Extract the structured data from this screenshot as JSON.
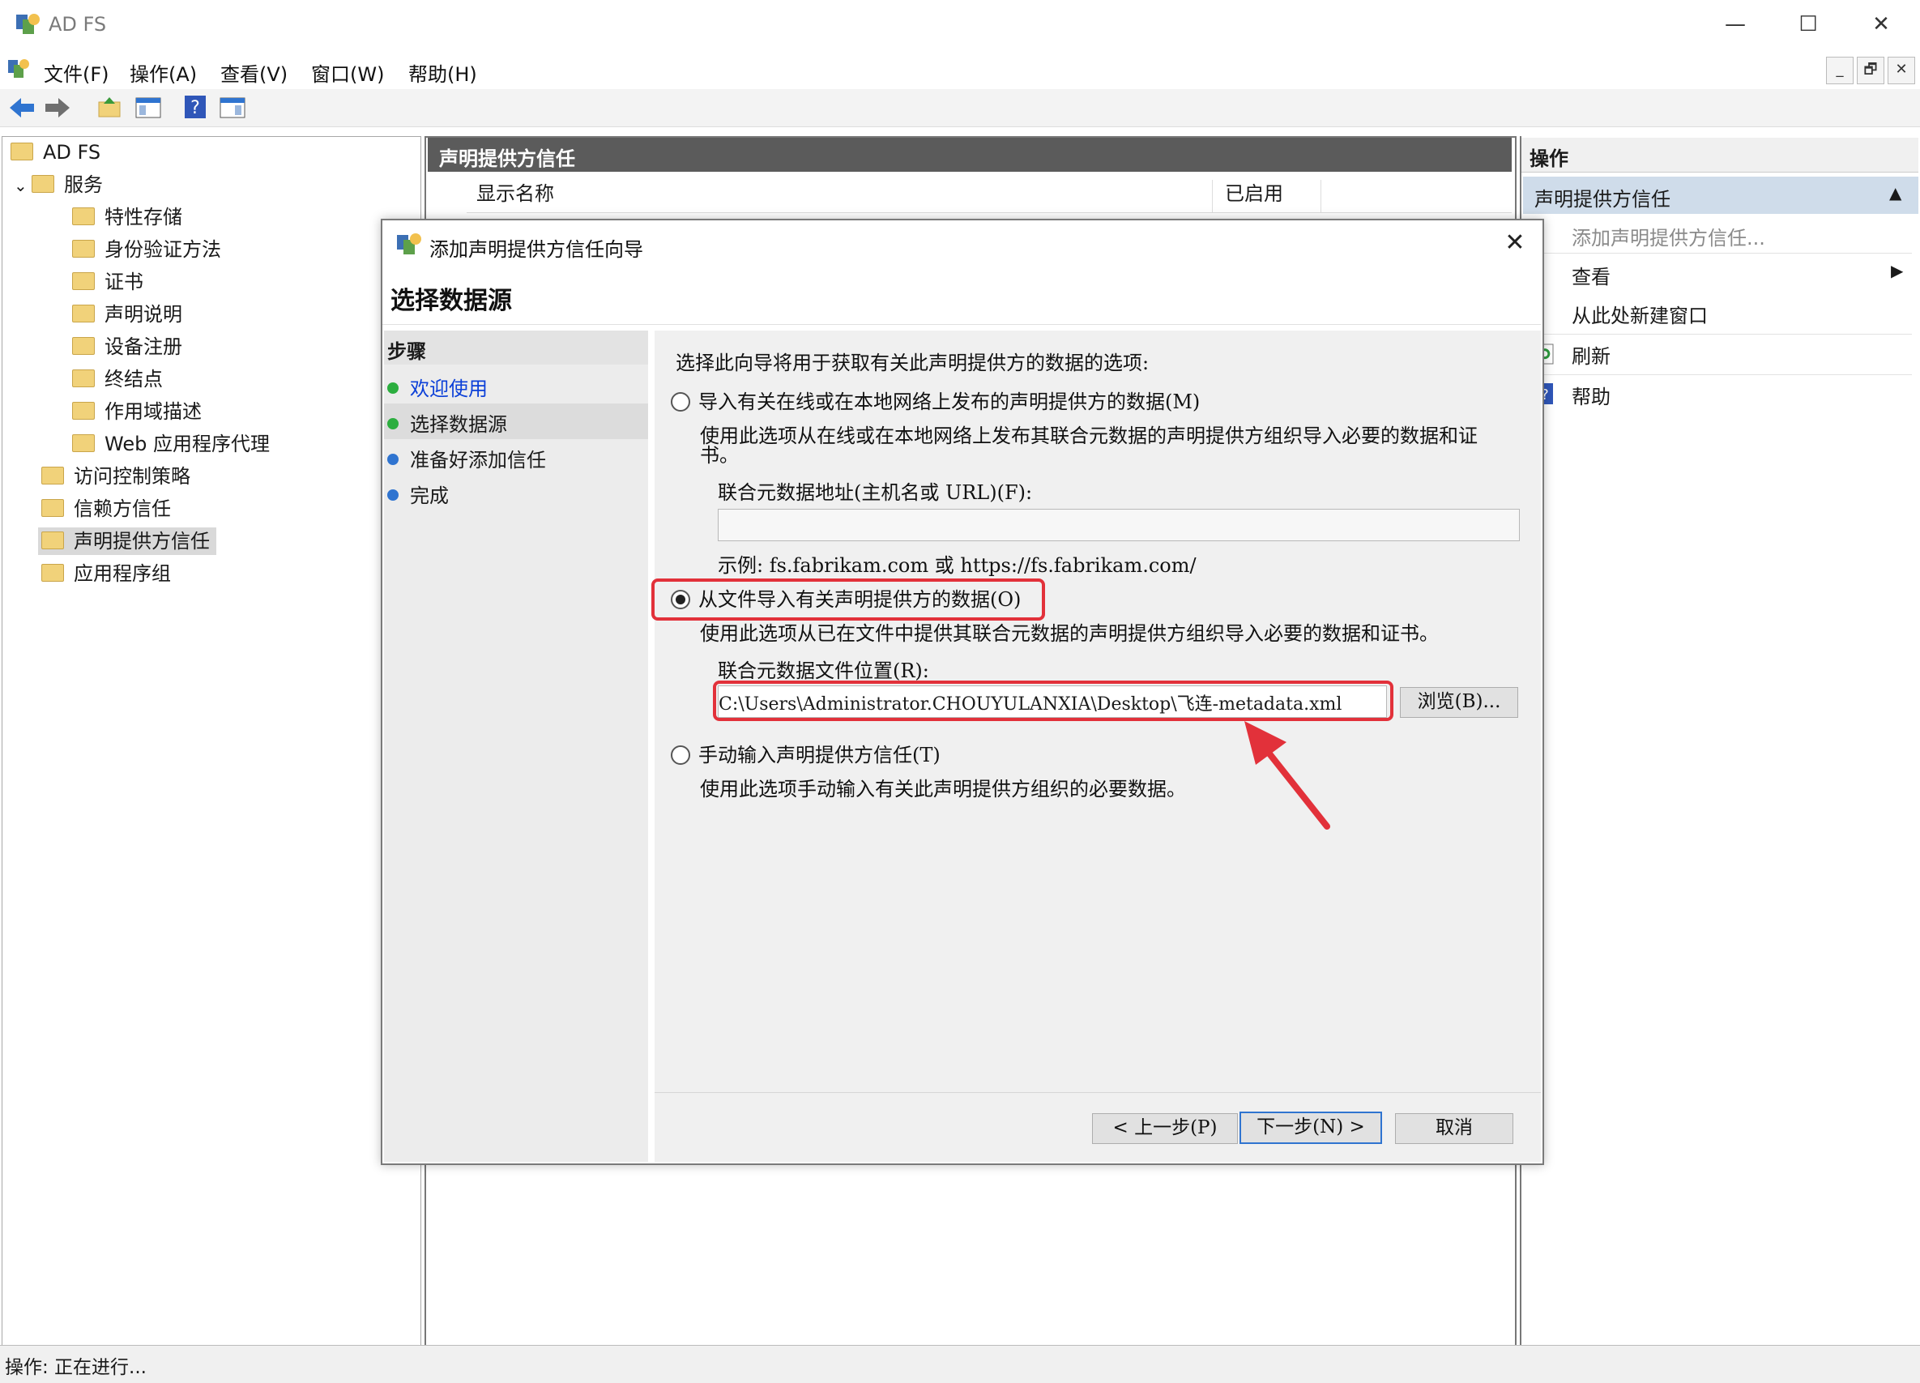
{
  "window": {
    "title": "AD FS",
    "minimize_glyph": "—",
    "maximize_glyph": "☐",
    "close_glyph": "✕"
  },
  "menu": [
    "文件(F)",
    "操作(A)",
    "查看(V)",
    "窗口(W)",
    "帮助(H)"
  ],
  "mdi_controls": [
    "_",
    "🗗",
    "✕"
  ],
  "tree": {
    "root": "AD FS",
    "services": "服务",
    "service_children": [
      "特性存储",
      "身份验证方法",
      "证书",
      "声明说明",
      "设备注册",
      "终结点",
      "作用域描述",
      "Web 应用程序代理"
    ],
    "access_control": "访问控制策略",
    "relying_party": "信赖方信任",
    "claims_provider": "声明提供方信任",
    "app_groups": "应用程序组"
  },
  "center": {
    "header": "声明提供方信任",
    "col_display_name": "显示名称",
    "col_enabled": "已启用"
  },
  "actions": {
    "title": "操作",
    "section": "声明提供方信任",
    "add": "添加声明提供方信任...",
    "view": "查看",
    "new_window": "从此处新建窗口",
    "refresh": "刷新",
    "help": "帮助"
  },
  "status": "操作: 正在进行...",
  "dialog": {
    "title": "添加声明提供方信任向导",
    "heading": "选择数据源",
    "steps_title": "步骤",
    "steps": [
      "欢迎使用",
      "选择数据源",
      "准备好添加信任",
      "完成"
    ],
    "intro": "选择此向导将用于获取有关此声明提供方的数据的选项:",
    "option1_label": "导入有关在线或在本地网络上发布的声明提供方的数据(M)",
    "option1_desc_line1": "使用此选项从在线或在本地网络上发布其联合元数据的声明提供方组织导入必要的数据和证",
    "option1_desc_line2": "书。",
    "url_label": "联合元数据地址(主机名或 URL)(F):",
    "url_value": "",
    "url_example": "示例: fs.fabrikam.com 或 https://fs.fabrikam.com/",
    "option2_label": "从文件导入有关声明提供方的数据(O)",
    "option2_desc": "使用此选项从已在文件中提供其联合元数据的声明提供方组织导入必要的数据和证书。",
    "file_label": "联合元数据文件位置(R):",
    "file_value": "C:\\Users\\Administrator.CHOUYULANXIA\\Desktop\\飞连-metadata.xml",
    "browse": "浏览(B)...",
    "option3_label": "手动输入声明提供方信任(T)",
    "option3_desc": "使用此选项手动输入有关此声明提供方组织的必要数据。",
    "prev": "< 上一步(P)",
    "next": "下一步(N) >",
    "cancel": "取消"
  },
  "colors": {
    "center_header_bg": "#5b5b5b",
    "actions_section_bg": "#cfdcea",
    "step_done": "#2cae3f",
    "step_pending": "#2f74d0",
    "link_blue": "#0b3fd8",
    "highlight_red": "#e2313a",
    "primary_border": "#2f74d0"
  }
}
